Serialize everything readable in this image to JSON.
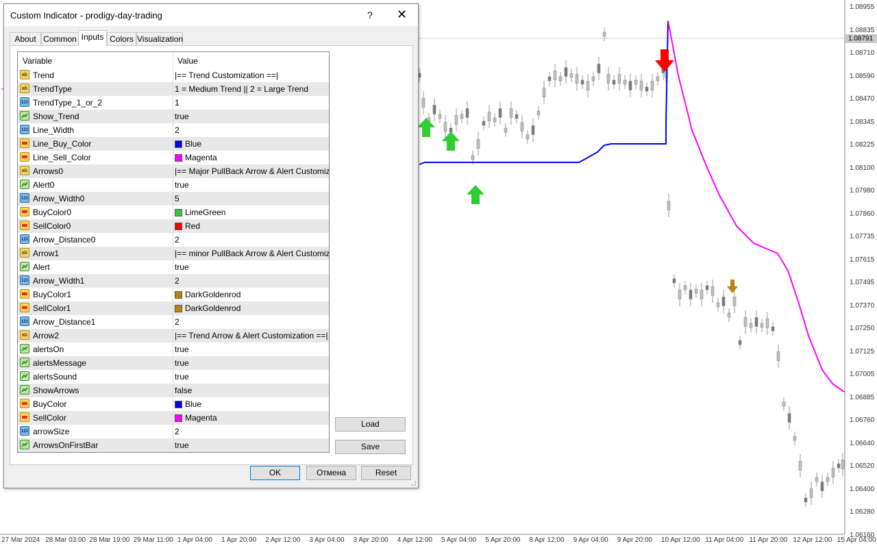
{
  "dialog": {
    "title": "Custom Indicator - prodigy-day-trading",
    "help": "?",
    "close": "✕",
    "tabs": [
      "About",
      "Common",
      "Inputs",
      "Colors",
      "Visualization"
    ],
    "active_tab": "Inputs",
    "grid_headers": {
      "variable": "Variable",
      "value": "Value"
    },
    "rows": [
      {
        "icon": "ab",
        "variable": "Trend",
        "value": "|== Trend Customization ==|"
      },
      {
        "icon": "ab",
        "variable": "TrendType",
        "value": "1 = Medium Trend || 2 = Large Trend"
      },
      {
        "icon": "num",
        "variable": "TrendType_1_or_2",
        "value": "1"
      },
      {
        "icon": "bool",
        "variable": "Show_Trend",
        "value": "true"
      },
      {
        "icon": "num",
        "variable": "Line_Width",
        "value": "2"
      },
      {
        "icon": "color",
        "variable": "Line_Buy_Color",
        "value": "Blue",
        "swatch": "#0000ff"
      },
      {
        "icon": "color",
        "variable": "Line_Sell_Color",
        "value": "Magenta",
        "swatch": "#ff00ff"
      },
      {
        "icon": "ab",
        "variable": "Arrows0",
        "value": "|== Major PullBack Arrow & Alert Customizati..."
      },
      {
        "icon": "bool",
        "variable": "Alert0",
        "value": "true"
      },
      {
        "icon": "num",
        "variable": "Arrow_Width0",
        "value": "5"
      },
      {
        "icon": "color",
        "variable": "BuyColor0",
        "value": "LimeGreen",
        "swatch": "#32cd32"
      },
      {
        "icon": "color",
        "variable": "SellColor0",
        "value": "Red",
        "swatch": "#ff0000"
      },
      {
        "icon": "num",
        "variable": "Arrow_Distance0",
        "value": "2"
      },
      {
        "icon": "ab",
        "variable": "Arrow1",
        "value": "|== minor PullBack Arrow & Alert Customizati..."
      },
      {
        "icon": "bool",
        "variable": "Alert",
        "value": "true"
      },
      {
        "icon": "num",
        "variable": "Arrow_Width1",
        "value": "2"
      },
      {
        "icon": "color",
        "variable": "BuyColor1",
        "value": "DarkGoldenrod",
        "swatch": "#b8860b"
      },
      {
        "icon": "color",
        "variable": "SellColor1",
        "value": "DarkGoldenrod",
        "swatch": "#b8860b"
      },
      {
        "icon": "num",
        "variable": "Arrow_Distance1",
        "value": "2"
      },
      {
        "icon": "ab",
        "variable": "Arrow2",
        "value": "|== Trend Arrow & Alert Customization ==|"
      },
      {
        "icon": "bool",
        "variable": "alertsOn",
        "value": "true"
      },
      {
        "icon": "bool",
        "variable": "alertsMessage",
        "value": "true"
      },
      {
        "icon": "bool",
        "variable": "alertsSound",
        "value": "true"
      },
      {
        "icon": "bool",
        "variable": "ShowArrows",
        "value": "false"
      },
      {
        "icon": "color",
        "variable": "BuyColor",
        "value": "Blue",
        "swatch": "#0000ff"
      },
      {
        "icon": "color",
        "variable": "SellColor",
        "value": "Magenta",
        "swatch": "#ff00ff"
      },
      {
        "icon": "num",
        "variable": "arrowSize",
        "value": "2"
      },
      {
        "icon": "bool",
        "variable": "ArrowsOnFirstBar",
        "value": "true"
      }
    ],
    "buttons": {
      "load": "Load",
      "save": "Save",
      "ok": "OK",
      "cancel": "Отмена",
      "reset": "Reset"
    }
  },
  "icon_text": {
    "ab": "ab",
    "num": "123",
    "bool": "",
    "color": ""
  },
  "chart": {
    "current_price": "1.08791",
    "price_labels": [
      "1.08955",
      "1.08835",
      "1.08710",
      "1.08590",
      "1.08470",
      "1.08345",
      "1.08225",
      "1.08100",
      "1.07980",
      "1.07860",
      "1.07735",
      "1.07615",
      "1.07495",
      "1.07370",
      "1.07250",
      "1.07125",
      "1.07005",
      "1.06885",
      "1.06760",
      "1.06640",
      "1.06520",
      "1.06400",
      "1.06280",
      "1.06160"
    ],
    "time_labels": [
      "27 Mar 2024",
      "28 Mar 03:00",
      "28 Mar 19:00",
      "29 Mar 11:00",
      "1 Apr 04:00",
      "1 Apr 20:00",
      "2 Apr 12:00",
      "3 Apr 04:00",
      "3 Apr 20:00",
      "4 Apr 12:00",
      "5 Apr 04:00",
      "5 Apr 20:00",
      "8 Apr 12:00",
      "9 Apr 04:00",
      "9 Apr 20:00",
      "10 Apr 12:00",
      "11 Apr 04:00",
      "11 Apr 20:00",
      "12 Apr 12:00",
      "15 Apr 04:00"
    ],
    "colors": {
      "buy_line": "#0000ff",
      "sell_line": "#ff00ff",
      "buy_arrow": "#32cd32",
      "sell_arrow": "#ff0000",
      "minor_arrow": "#b8860b"
    }
  }
}
